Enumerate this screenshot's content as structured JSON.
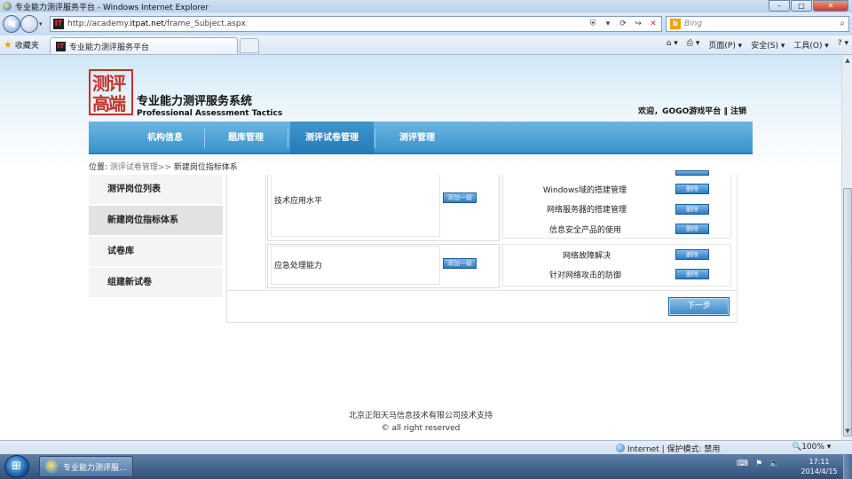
{
  "window": {
    "title": "专业能力测评服务平台 - Windows Internet Explorer",
    "min_label": "–",
    "max_label": "□",
    "close_label": "✕"
  },
  "browser": {
    "back_glyph": "◀",
    "fwd_glyph": "▶",
    "url_prefix": "http://academy.",
    "url_host": "itpat.net",
    "url_path": "/frame_Subject.aspx",
    "search_placeholder": "Bing",
    "favorites_label": "收藏夹",
    "tab_title": "专业能力测评服务平台",
    "commands": [
      "页面(P) ▾",
      "安全(S) ▾",
      "工具(O) ▾",
      "? ▾"
    ]
  },
  "site": {
    "logo_seal": "测评\n高端",
    "name_cn": "专业能力测评服务系统",
    "name_en": "Professional Assessment Tactics",
    "welcome": "欢迎，GOGO游戏平台 ‖ 注销",
    "nav": [
      "机构信息",
      "题库管理",
      "测评试卷管理",
      "测评管理"
    ],
    "breadcrumb_prefix": "位置: ",
    "breadcrumb_link": "测评试卷管理>>",
    "breadcrumb_current": " 新建岗位指标体系",
    "sidebar": [
      "测评岗位列表",
      "新建岗位指标体系",
      "试卷库",
      "组建新试卷"
    ]
  },
  "form": {
    "abilities": [
      {
        "name": "技术应用水平",
        "add_label": "添加一级",
        "subitems": [
          "Windows域的搭建管理",
          "网络服务器的搭建管理",
          "信息安全产品的使用"
        ]
      },
      {
        "name": "应急处理能力",
        "add_label": "添加一级",
        "subitems": [
          "网络故障解决",
          "针对网络攻击的防御"
        ]
      }
    ],
    "delete_label": "删除",
    "next_label": "下一步"
  },
  "footer": {
    "line1": "北京正阳天马信息技术有限公司技术支持",
    "line2": "© all right reserved"
  },
  "status": {
    "zone": "Internet | 保护模式: 禁用",
    "zoom": "🔍100% ▾"
  },
  "taskbar": {
    "task_label": "专业能力测评服...",
    "time": "17:11",
    "date": "2014/4/15"
  }
}
